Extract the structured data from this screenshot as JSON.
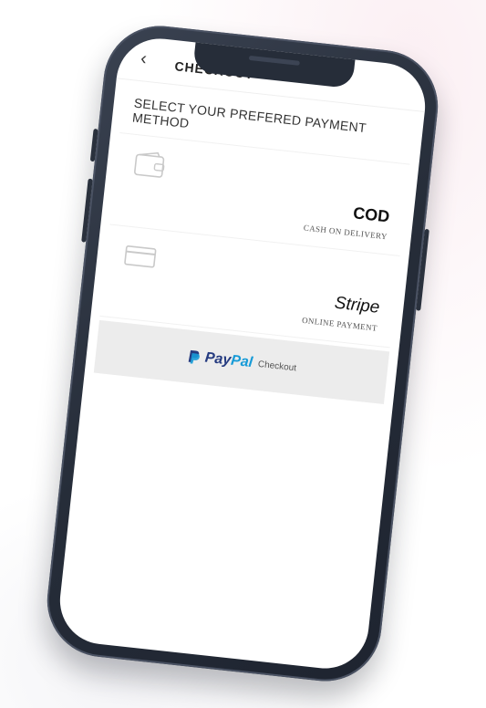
{
  "header": {
    "back_glyph": "‹",
    "title": "CHECKOUT"
  },
  "section": {
    "title": "SELECT YOUR PREFERED PAYMENT METHOD"
  },
  "methods": [
    {
      "name": "COD",
      "subtitle": "CASH ON DELIVERY",
      "icon": "wallet-icon"
    },
    {
      "name": "Stripe",
      "subtitle": "ONLINE PAYMENT",
      "icon": "credit-card-icon"
    }
  ],
  "paypal": {
    "brand_pay": "Pay",
    "brand_pal": "Pal",
    "label": "Checkout",
    "icon": "paypal-logo-icon",
    "colors": {
      "pay": "#253b80",
      "pal": "#179bd7"
    }
  },
  "colors": {
    "phone_frame": "#262d39",
    "screen_bg": "#ffffff",
    "paypal_button_bg": "#ececec"
  }
}
